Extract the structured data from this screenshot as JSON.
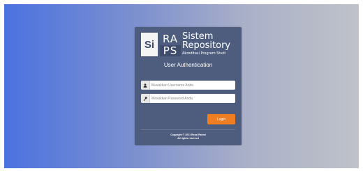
{
  "brand": {
    "logo_si": "Si",
    "logo_ra": "RA",
    "logo_ps": "PS",
    "title_line1": "Sistem",
    "title_line2": "Repository",
    "subtitle": "Akreditasi Program Studi"
  },
  "auth": {
    "title": "User Authentication",
    "username_placeholder": "Masukkan Username Anda",
    "password_placeholder": "Masukkan Password Anda",
    "login_label": "Login"
  },
  "footer": {
    "copyright": "Copyright © 2021 Rezal Rahmi",
    "rights": "All rights reserved"
  },
  "colors": {
    "accent": "#ef7d21",
    "card": "#4e5d7e"
  },
  "icons": {
    "username": "user-icon",
    "password": "key-icon"
  }
}
